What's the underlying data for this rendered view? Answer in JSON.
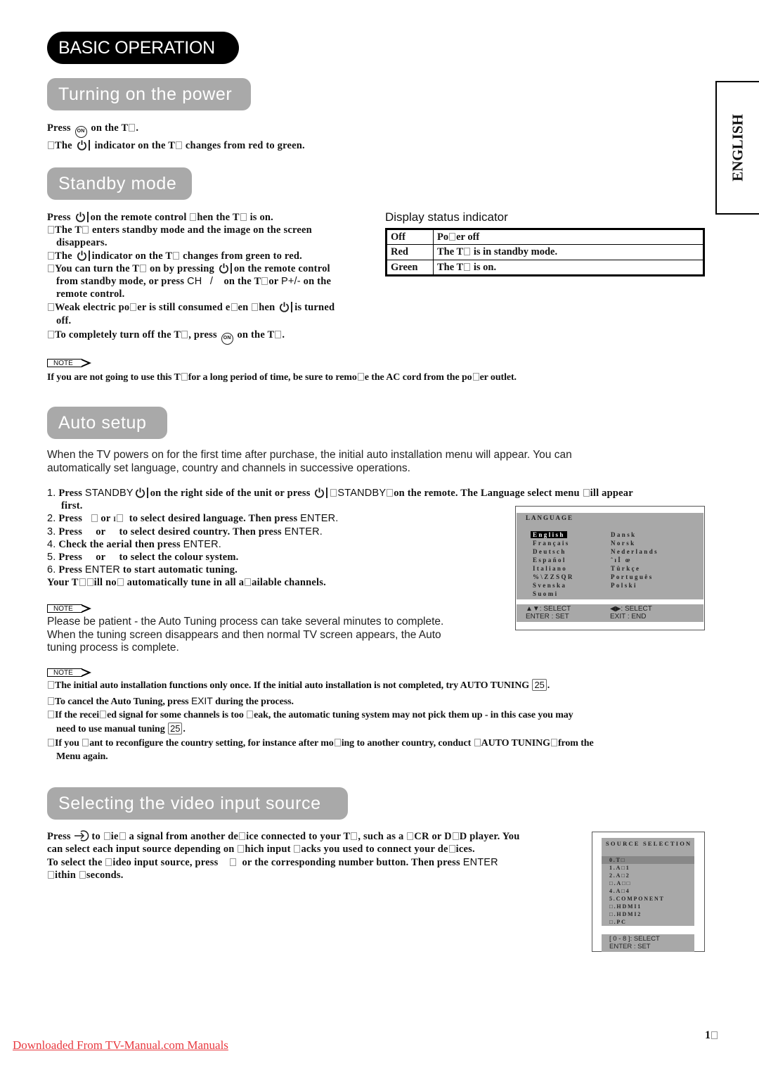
{
  "page": {
    "main_heading": "BASIC OPERATION",
    "language_tab": "ENGLISH",
    "page_number": "1",
    "footer_link": "Downloaded From TV-Manual.com Manuals"
  },
  "icons": {
    "on_button": "ON",
    "standby_power": "power-symbol",
    "input": "input-arrow-icon"
  },
  "turning_on": {
    "heading": "Turning on the power",
    "line1_pre": "Press",
    "line1_post": "on the T",
    "line2_pre": "The",
    "line2_post": "indicator on the T",
    "line2_tail": "changes from red to green."
  },
  "standby": {
    "heading": "Standby mode",
    "lines": [
      {
        "pre": "Press",
        "post": "on the remote control",
        "mid": "hen the T",
        "tail": "is on."
      },
      {
        "text": "The T",
        "tail": "enters standby mode and the image on the screen"
      },
      {
        "text": "disappears."
      },
      {
        "pre": "The",
        "post": "indicator on the T",
        "tail": "changes from green to red."
      },
      {
        "pre": "You can turn the T",
        "mid": "on by pressing",
        "post": "on the remote control"
      },
      {
        "text": "from standby mode, or press",
        "ch": "CH",
        "slash": "/",
        "mid": "on the T",
        "or": "or",
        "pkey": "P+/-",
        "tail": "on the"
      },
      {
        "text": "remote control."
      },
      {
        "pre": "Weak electric po",
        "mid": "er is still consumed e",
        "mid2": "en",
        "mid3": "hen",
        "post": "is turned"
      },
      {
        "text": "off."
      },
      {
        "pre": "To completely turn off the T",
        "mid": ", press",
        "post": "on the T"
      }
    ]
  },
  "status_indicator": {
    "title": "Display status indicator",
    "rows": [
      {
        "state": "Off",
        "desc_a": "Po",
        "desc_b": "er off"
      },
      {
        "state": "Red",
        "desc_a": "The T",
        "desc_b": "is in standby mode."
      },
      {
        "state": "Green",
        "desc_a": "The T",
        "desc_b": "is on."
      }
    ]
  },
  "note1": {
    "label": "NOTE",
    "text_a": "If you are not going to use this T",
    "text_b": "for a long period of time, be sure to remo",
    "text_c": "e the AC cord from the po",
    "text_d": "er outlet."
  },
  "auto_setup": {
    "heading": "Auto setup",
    "intro_1": "When the TV powers on for the first time after purchase, the initial auto installation menu will appear. You can",
    "intro_2": "automatically set language, country and channels in successive operations.",
    "steps": [
      {
        "num": "1.",
        "a": "Press",
        "key": "STANDBY",
        "b": "on the right side of the unit or press",
        "c": "STANDBY",
        "d": "on the remote. The Language select menu",
        "e": "ill appear",
        "cont": "first."
      },
      {
        "num": "2.",
        "a": "Press",
        "b": "or",
        "c": "to select desired language. Then press",
        "key": "ENTER."
      },
      {
        "num": "3.",
        "a": "Press",
        "b": "or",
        "c": "to select desired country. Then press",
        "key": "ENTER."
      },
      {
        "num": "4.",
        "a": "Check the aerial then press",
        "key": "ENTER."
      },
      {
        "num": "5.",
        "a": "Press",
        "b": "or",
        "c": "to select the colour system."
      },
      {
        "num": "6.",
        "a": "Press",
        "key": "ENTER",
        "c": "to start automatic tuning."
      }
    ],
    "result_a": "Your T",
    "result_b": "ill no",
    "result_c": "automatically tune in all a",
    "result_d": "ailable channels.",
    "note_label": "NOTE",
    "note_lines": [
      "Please be patient - the Auto Tuning process can take several minutes to complete.",
      "When the tuning screen disappears and then normal TV screen appears, the Auto",
      "tuning process is complete."
    ]
  },
  "language_menu": {
    "title": "LANGUAGE",
    "left_items": [
      "English",
      "Français",
      "Deutsch",
      "Español",
      "Italiano",
      "%\\ZZSQR",
      "Svenska",
      "Suomi"
    ],
    "right_items": [
      "Dansk",
      "Norsk",
      "Nederlands",
      "ˆıİ œ",
      "Türkçe",
      "Português",
      "Polski"
    ],
    "selected": "English",
    "foot_left_1": "▲▼: SELECT",
    "foot_left_2": "ENTER : SET",
    "foot_right_1": "◀▶: SELECT",
    "foot_right_2": "EXIT : END"
  },
  "note2": {
    "label": "NOTE",
    "items": [
      {
        "a": "The initial auto installation functions only once. If the initial auto installation is not completed, try AUTO TUNING",
        "ref": "25",
        "b": "."
      },
      {
        "a": "To cancel the Auto Tuning, press",
        "key": "EXIT",
        "b": "during the process."
      },
      {
        "a": "If the recei",
        "b": "ed signal for some channels is too",
        "c": "eak, the automatic tuning system may not pick them up - in this case you may",
        "cont": "need to use manual tuning",
        "ref": "25",
        "tail": "."
      },
      {
        "a": "If you",
        "b": "ant to reconfigure the country setting, for instance after mo",
        "c": "ing to another country, conduct",
        "d": "AUTO TUNING",
        "e": "from the",
        "cont": "Menu again."
      }
    ]
  },
  "input_source": {
    "heading": "Selecting the video input source",
    "p1_a": "Press",
    "p1_b": "to",
    "p1_c": "ie",
    "p1_d": "a signal from another de",
    "p1_e": "ice connected to your T",
    "p1_f": ", such as a",
    "p1_g": "CR or D",
    "p1_h": "D player. You",
    "p2_a": "can select each input source depending on",
    "p2_b": "hich input",
    "p2_c": "acks you used to connect your de",
    "p2_d": "ices.",
    "p3_a": "To select the",
    "p3_b": "ideo input source, press",
    "p3_c": "or the corresponding number button. Then press",
    "p3_key": "ENTER",
    "p4_a": "ithin",
    "p4_b": "seconds."
  },
  "source_menu": {
    "title": "SOURCE SELECTION",
    "items": [
      "0.TV",
      "1.AV1",
      "2.AV2",
      "3.AV3",
      "4.AV4",
      "5.COMPONENT",
      "6.HDMI1",
      "7.HDMI2",
      "8.PC"
    ],
    "display_items": [
      "0.T□",
      "1.A□1",
      "2.A□2",
      "□.A□□",
      "4.A□4",
      "5.COMPONENT",
      "□.HDMI1",
      "□.HDMI2",
      "□.PC"
    ],
    "selected_index": 0,
    "foot_1": "[ 0 - 8 ]: SELECT",
    "foot_2": "ENTER : SET"
  }
}
